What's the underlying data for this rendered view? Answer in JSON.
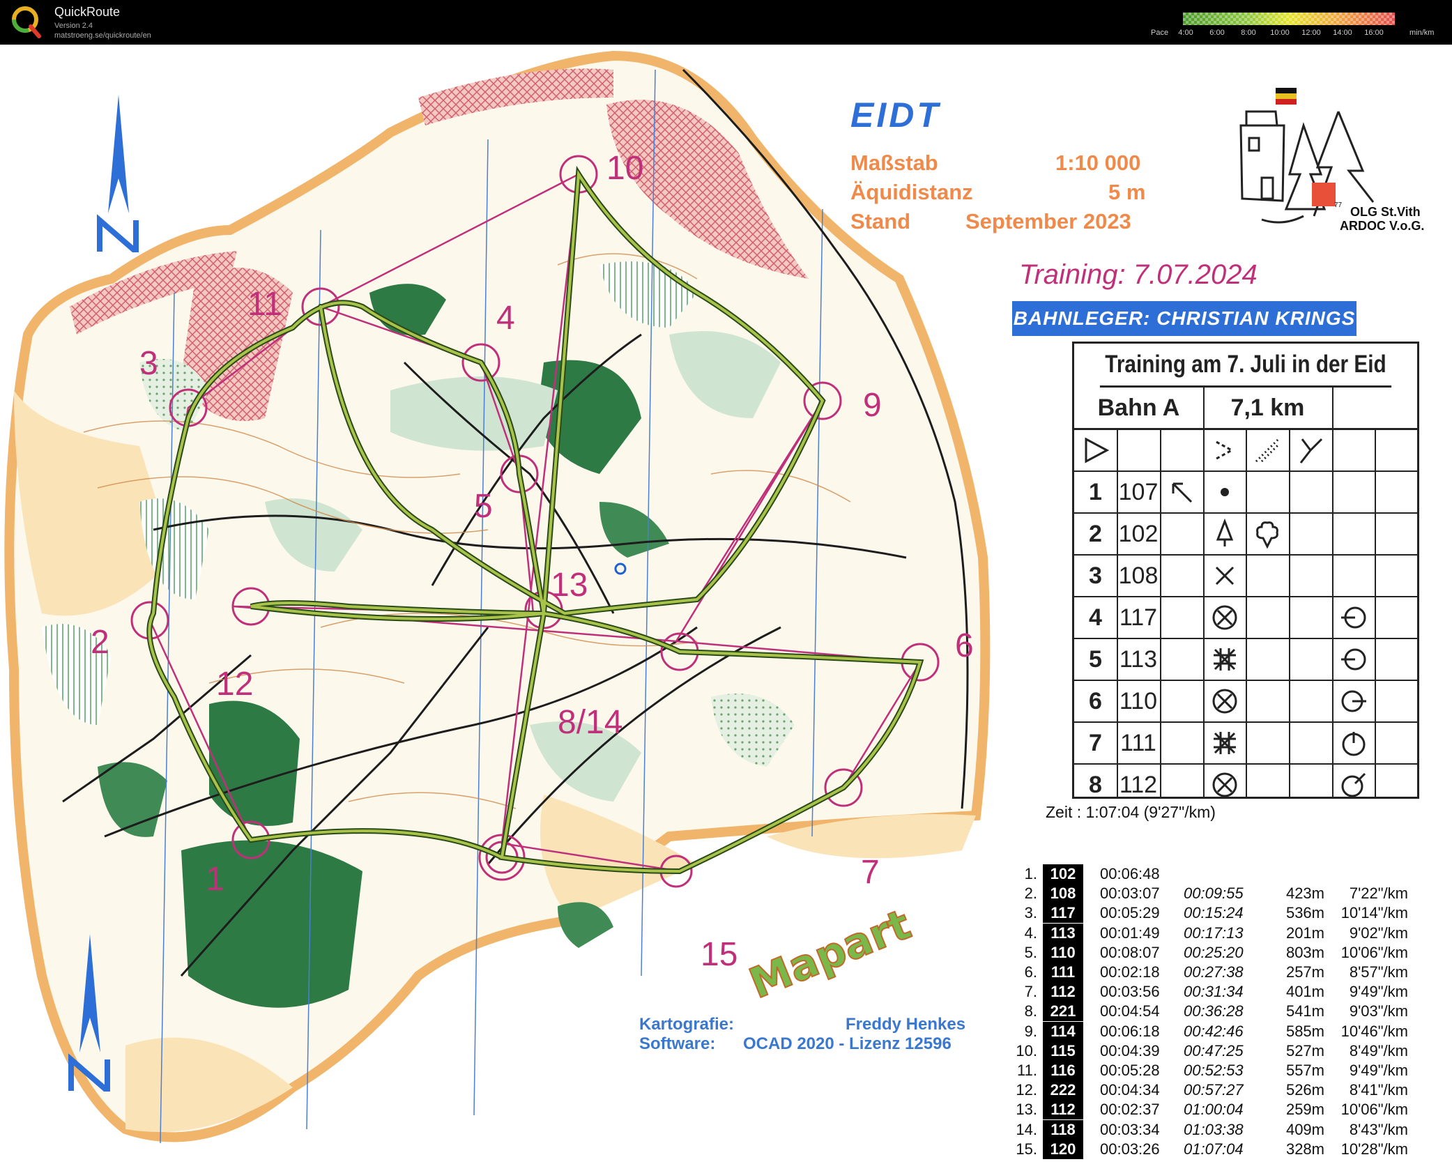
{
  "app": {
    "title": "QuickRoute",
    "version": "Version 2.4",
    "url": "matstroeng.se/quickroute/en",
    "logo_icon": "quickroute-q-logo"
  },
  "pace_scale": {
    "label": "Pace",
    "ticks": [
      "4:00",
      "6:00",
      "8:00",
      "10:00",
      "12:00",
      "14:00",
      "16:00"
    ],
    "unit": "min/km",
    "colors": [
      "#4a9a2a",
      "#8cc63f",
      "#e5e52a",
      "#f0a040",
      "#e54c4c"
    ]
  },
  "map": {
    "name": "EIDT",
    "scale_label": "Maßstab",
    "scale_value": "1:10 000",
    "contour_label": "Äquidistanz",
    "contour_value": "5 m",
    "date_label": "Stand",
    "date_value": "September 2023",
    "training_date": "Training: 7.07.2024",
    "course_setter": "BAHNLEGER: CHRISTIAN KRINGS",
    "club_line1": "OLG St.Vith",
    "club_line2": "ARDOC V.o.G.",
    "club_badge": "77",
    "cartography_label": "Kartografie:",
    "cartographer": "Freddy Henkes",
    "software_label": "Software:",
    "software_value": "OCAD 2020 - Lizenz 12596",
    "mapart_logo": "Mapart",
    "north_label": "N",
    "control_numbers": [
      "1",
      "2",
      "3",
      "4",
      "5",
      "6",
      "7",
      "8/14",
      "9",
      "10",
      "11",
      "12",
      "13",
      "15"
    ]
  },
  "description": {
    "title": "Training am 7. Juli in der Eid",
    "course": "Bahn A",
    "length": "7,1 km",
    "rows": [
      {
        "num": "1",
        "code": "107"
      },
      {
        "num": "2",
        "code": "102"
      },
      {
        "num": "3",
        "code": "108"
      },
      {
        "num": "4",
        "code": "117"
      },
      {
        "num": "5",
        "code": "113"
      },
      {
        "num": "6",
        "code": "110"
      },
      {
        "num": "7",
        "code": "111"
      },
      {
        "num": "8",
        "code": "112"
      }
    ]
  },
  "result": {
    "time_summary": "Zeit : 1:07:04 (9'27\"/km)",
    "splits": [
      {
        "idx": "1.",
        "code": "102",
        "leg": "00:06:48",
        "cum": "",
        "dist": "",
        "pace": ""
      },
      {
        "idx": "2.",
        "code": "108",
        "leg": "00:03:07",
        "cum": "00:09:55",
        "dist": "423m",
        "pace": "7'22\"/km"
      },
      {
        "idx": "3.",
        "code": "117",
        "leg": "00:05:29",
        "cum": "00:15:24",
        "dist": "536m",
        "pace": "10'14\"/km"
      },
      {
        "idx": "4.",
        "code": "113",
        "leg": "00:01:49",
        "cum": "00:17:13",
        "dist": "201m",
        "pace": "9'02\"/km"
      },
      {
        "idx": "5.",
        "code": "110",
        "leg": "00:08:07",
        "cum": "00:25:20",
        "dist": "803m",
        "pace": "10'06\"/km"
      },
      {
        "idx": "6.",
        "code": "111",
        "leg": "00:02:18",
        "cum": "00:27:38",
        "dist": "257m",
        "pace": "8'57\"/km"
      },
      {
        "idx": "7.",
        "code": "112",
        "leg": "00:03:56",
        "cum": "00:31:34",
        "dist": "401m",
        "pace": "9'49\"/km"
      },
      {
        "idx": "8.",
        "code": "221",
        "leg": "00:04:54",
        "cum": "00:36:28",
        "dist": "541m",
        "pace": "9'03\"/km"
      },
      {
        "idx": "9.",
        "code": "114",
        "leg": "00:06:18",
        "cum": "00:42:46",
        "dist": "585m",
        "pace": "10'46\"/km"
      },
      {
        "idx": "10.",
        "code": "115",
        "leg": "00:04:39",
        "cum": "00:47:25",
        "dist": "527m",
        "pace": "8'49\"/km"
      },
      {
        "idx": "11.",
        "code": "116",
        "leg": "00:05:28",
        "cum": "00:52:53",
        "dist": "557m",
        "pace": "9'49\"/km"
      },
      {
        "idx": "12.",
        "code": "222",
        "leg": "00:04:34",
        "cum": "00:57:27",
        "dist": "526m",
        "pace": "8'41\"/km"
      },
      {
        "idx": "13.",
        "code": "112",
        "leg": "00:02:37",
        "cum": "01:00:04",
        "dist": "259m",
        "pace": "10'06\"/km"
      },
      {
        "idx": "14.",
        "code": "118",
        "leg": "00:03:34",
        "cum": "01:03:38",
        "dist": "409m",
        "pace": "8'43\"/km"
      },
      {
        "idx": "15.",
        "code": "120",
        "leg": "00:03:26",
        "cum": "01:07:04",
        "dist": "328m",
        "pace": "10'28\"/km"
      }
    ]
  }
}
